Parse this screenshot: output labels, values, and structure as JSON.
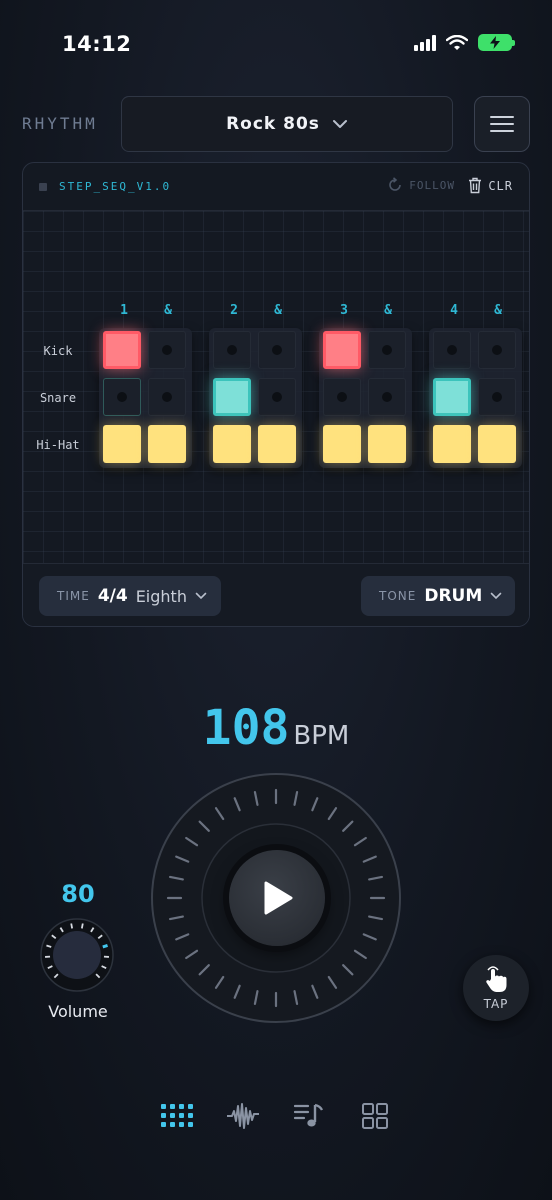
{
  "status": {
    "time": "14:12"
  },
  "header": {
    "brand": "RHYTHM",
    "preset": "Rock 80s"
  },
  "sequencer": {
    "name": "STEP_SEQ_V1.0",
    "follow_label": "FOLLOW",
    "clear_label": "CLR",
    "beats": [
      "1",
      "&",
      "2",
      "&",
      "3",
      "&",
      "4",
      "&"
    ],
    "rows": [
      {
        "label": "Kick",
        "steps": [
          1,
          0,
          0,
          0,
          1,
          0,
          0,
          0
        ]
      },
      {
        "label": "Snare",
        "steps": [
          0,
          0,
          1,
          0,
          0,
          0,
          1,
          0
        ]
      },
      {
        "label": "Hi-Hat",
        "steps": [
          1,
          1,
          1,
          1,
          1,
          1,
          1,
          1
        ]
      }
    ],
    "time": {
      "key": "TIME",
      "value": "4/4",
      "sub": "Eighth"
    },
    "tone": {
      "key": "TONE",
      "value": "DRUM"
    }
  },
  "tempo": {
    "bpm": "108",
    "unit": "BPM"
  },
  "volume": {
    "value": "80",
    "label": "Volume"
  },
  "tap": {
    "label": "TAP"
  },
  "colors": {
    "accent": "#43c6ec",
    "kick": "#ff7f86",
    "snare": "#7ee0d8",
    "hihat": "#ffe27e"
  },
  "nav": {
    "items": [
      "grid-icon",
      "waveform-icon",
      "playlist-icon",
      "apps-icon"
    ],
    "active": 0
  }
}
